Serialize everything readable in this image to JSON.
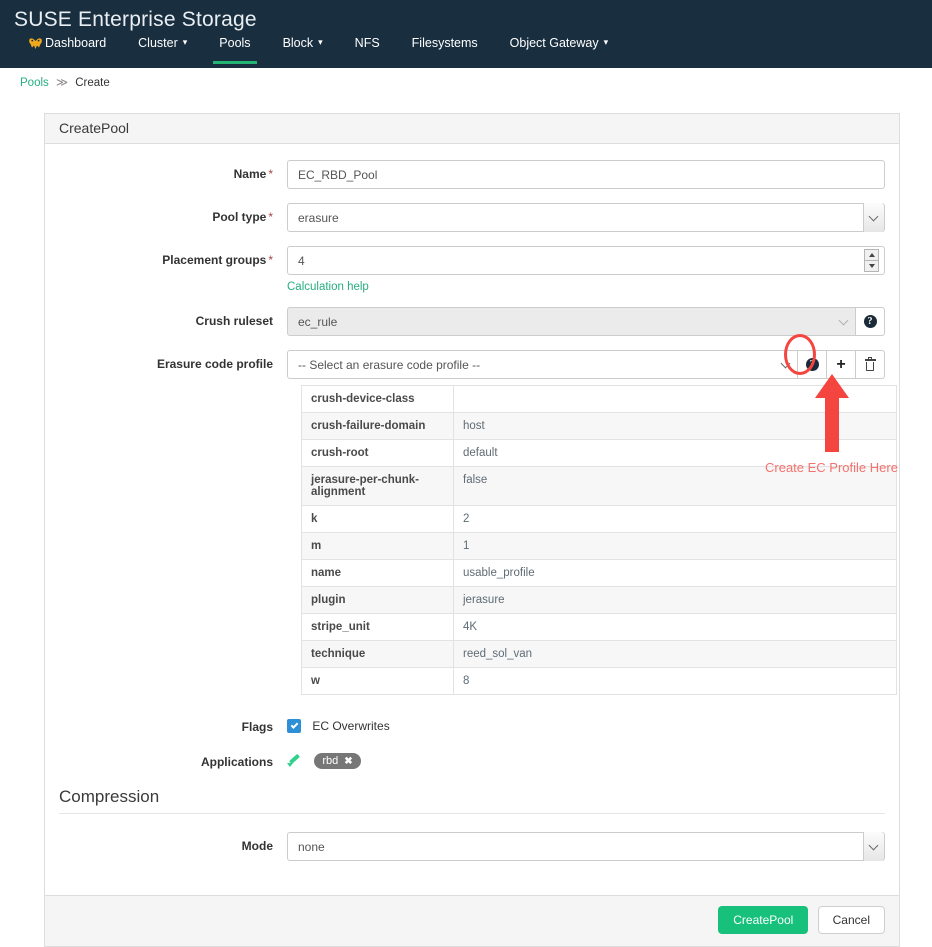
{
  "navbar": {
    "brand": "SUSE Enterprise Storage",
    "items": [
      {
        "label": "Dashboard",
        "icon": "geeko-icon",
        "active": false,
        "caret": ""
      },
      {
        "label": "Cluster",
        "icon": "",
        "active": false,
        "caret": "▾"
      },
      {
        "label": "Pools",
        "icon": "",
        "active": true,
        "caret": ""
      },
      {
        "label": "Block",
        "icon": "",
        "active": false,
        "caret": "▾"
      },
      {
        "label": "NFS",
        "icon": "",
        "active": false,
        "caret": ""
      },
      {
        "label": "Filesystems",
        "icon": "",
        "active": false,
        "caret": ""
      },
      {
        "label": "Object Gateway",
        "icon": "",
        "active": false,
        "caret": "▾"
      }
    ]
  },
  "breadcrumb": {
    "root": "Pools",
    "separator": "≫",
    "current": "Create"
  },
  "card": {
    "title": "CreatePool"
  },
  "form": {
    "name": {
      "label": "Name",
      "required": "*",
      "value": "EC_RBD_Pool"
    },
    "pool_type": {
      "label": "Pool type",
      "required": "*",
      "value": "erasure"
    },
    "placement_groups": {
      "label": "Placement groups",
      "required": "*",
      "value": "4",
      "help_link": "Calculation help"
    },
    "crush_ruleset": {
      "label": "Crush ruleset",
      "value": "ec_rule"
    },
    "erasure_code_profile": {
      "label": "Erasure code profile",
      "value": "-- Select an erasure code profile --"
    },
    "flags": {
      "label": "Flags",
      "checkbox_label": "EC Overwrites",
      "checked": true
    },
    "applications": {
      "label": "Applications",
      "badges": [
        {
          "label": "rbd",
          "remove": "✖"
        }
      ]
    }
  },
  "ec_profile_table": {
    "rows": [
      {
        "key": "crush-device-class",
        "value": ""
      },
      {
        "key": "crush-failure-domain",
        "value": "host"
      },
      {
        "key": "crush-root",
        "value": "default"
      },
      {
        "key": "jerasure-per-chunk-alignment",
        "value": "false"
      },
      {
        "key": "k",
        "value": "2"
      },
      {
        "key": "m",
        "value": "1"
      },
      {
        "key": "name",
        "value": "usable_profile"
      },
      {
        "key": "plugin",
        "value": "jerasure"
      },
      {
        "key": "stripe_unit",
        "value": "4K"
      },
      {
        "key": "technique",
        "value": "reed_sol_van"
      },
      {
        "key": "w",
        "value": "8"
      }
    ]
  },
  "compression": {
    "title": "Compression",
    "mode": {
      "label": "Mode",
      "value": "none"
    }
  },
  "footer": {
    "submit_label": "CreatePool",
    "cancel_label": "Cancel"
  },
  "annotation": {
    "text": "Create EC Profile Here",
    "color": "#f4736e",
    "shape_color": "#f4453f"
  },
  "colors": {
    "navbar_bg": "#192e3f",
    "accent_green": "#22b573",
    "link_green": "#27ae80",
    "primary_button": "#17c07b",
    "checkbox_blue": "#2d8fd5",
    "badge_gray": "#777777",
    "annotation_red": "#f4453f"
  }
}
